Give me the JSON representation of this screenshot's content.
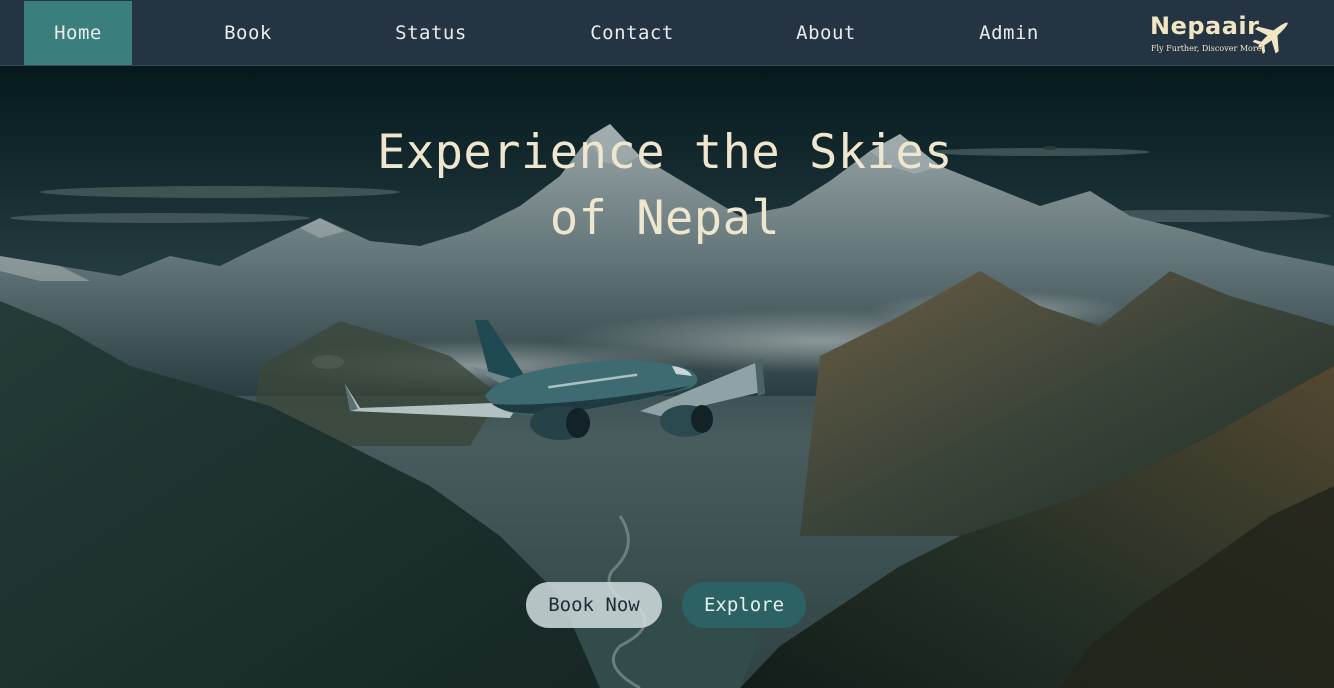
{
  "nav": {
    "items": [
      {
        "label": "Home",
        "active": true
      },
      {
        "label": "Book",
        "active": false
      },
      {
        "label": "Status",
        "active": false
      },
      {
        "label": "Contact",
        "active": false
      },
      {
        "label": "About",
        "active": false
      },
      {
        "label": "Admin",
        "active": false
      }
    ],
    "logo": {
      "name": "Nepaair",
      "tagline": "Fly Further, Discover More",
      "icon": "airplane-icon"
    }
  },
  "hero": {
    "title_line1": "Experience the Skies",
    "title_line2": "of Nepal",
    "background": "mountain-valley-with-airplane-image",
    "buttons": {
      "book_now": "Book Now",
      "explore": "Explore"
    }
  },
  "colors": {
    "nav_bg": "#253442",
    "nav_active": "#3a7e7e",
    "title": "#efe6cf",
    "explore_button": "#2d6265"
  }
}
